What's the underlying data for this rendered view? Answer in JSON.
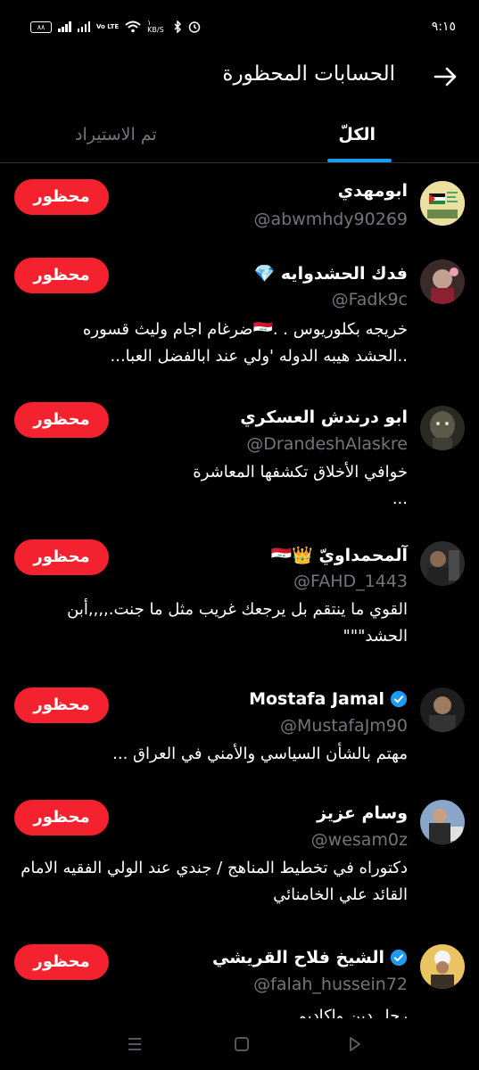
{
  "status_bar": {
    "time": "٩:١٥",
    "battery": "٨٨",
    "network_label": "Vo LTE",
    "speed": "١ KB/S"
  },
  "header": {
    "title": "الحسابات المحظورة"
  },
  "tabs": [
    {
      "label": "الكلّ",
      "active": true
    },
    {
      "label": "تم الاستيراد",
      "active": false
    }
  ],
  "accounts": [
    {
      "name": "ابومهدي",
      "handle": "@abwmhdy90269",
      "bio": "",
      "verified": false,
      "badge": ""
    },
    {
      "name": "فدك الحشدوايه 💎",
      "handle": "@Fadk9c",
      "bio": "خريجه بكلوريوس . .🇮🇶ضرغام اجام وليث قسوره ..الحشد هيبه الدوله 'ولي عند ابالفضل العبا...",
      "verified": false,
      "badge": ""
    },
    {
      "name": "ابو درندش العسكري",
      "handle": "@DrandeshAlaskre",
      "bio": "خوافي الأخلاق تكشفها المعاشرة ...",
      "verified": false,
      "badge": ""
    },
    {
      "name": "آلمحمداويّ 👑🇮🇶",
      "handle": "@FAHD_1443",
      "bio": "القوي ما ينتقم بل يرجعك غريب مثل ما جنت.,,,,أبن الحشد\"\"\"",
      "verified": false,
      "badge": ""
    },
    {
      "name": "Mostafa Jamal",
      "handle": "@MustafaJm90",
      "bio": "مهتم بالشأن السياسي والأمني في العراق ...",
      "verified": true,
      "badge": ""
    },
    {
      "name": "وسام عزيز",
      "handle": "@wesam0z",
      "bio": "دكتوراه في تخطيط المناهج / جندي عند الولي الفقيه الامام القائد علي الخامنائي",
      "verified": false,
      "badge": ""
    },
    {
      "name": "الشيخ فلاح القريشي",
      "handle": "@falah_hussein72",
      "bio": "رجل دين واكاديم",
      "verified": true,
      "badge": ""
    }
  ],
  "blocked_label": "محظور",
  "colors": {
    "accent": "#1d9bf0",
    "blocked": "#f4212e",
    "muted": "#71767b"
  }
}
